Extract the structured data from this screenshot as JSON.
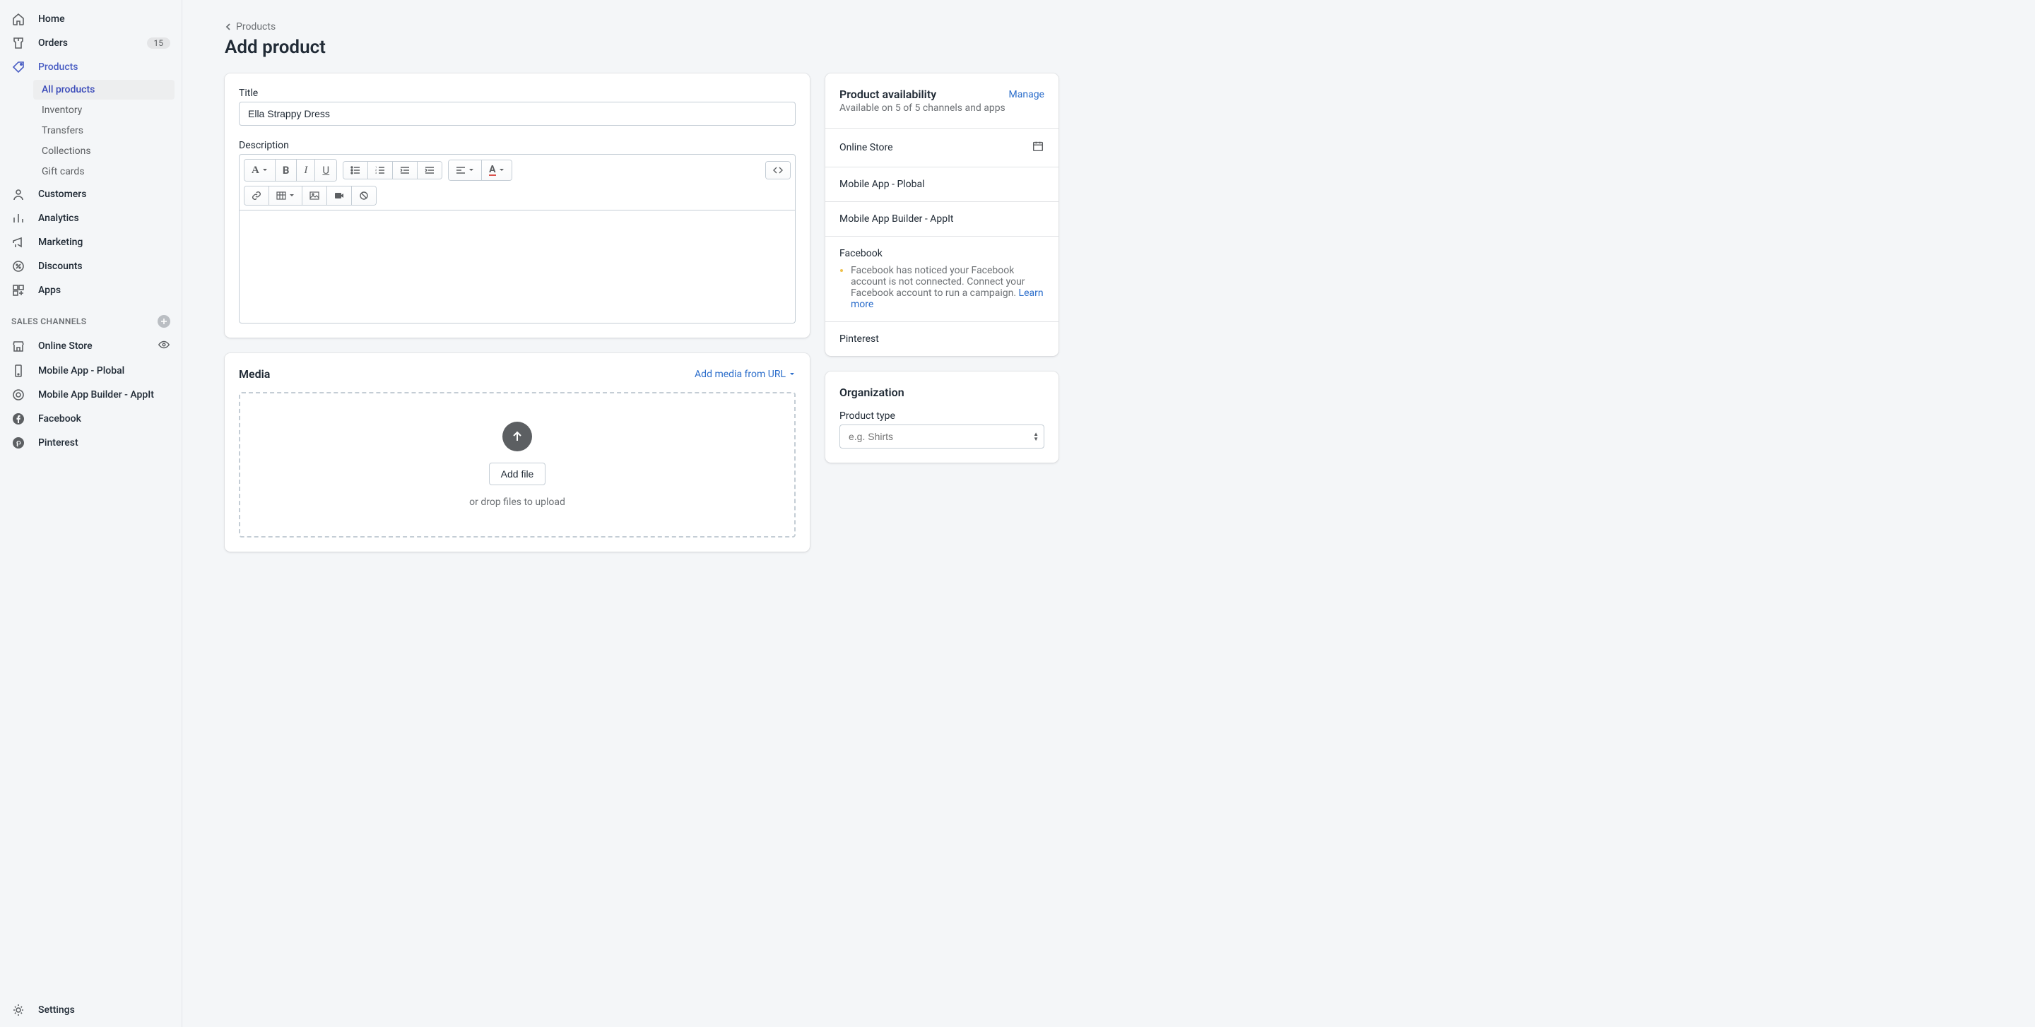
{
  "nav": {
    "home": "Home",
    "orders": "Orders",
    "orders_badge": "15",
    "products": "Products",
    "products_sub": {
      "all": "All products",
      "inventory": "Inventory",
      "transfers": "Transfers",
      "collections": "Collections",
      "gift_cards": "Gift cards"
    },
    "customers": "Customers",
    "analytics": "Analytics",
    "marketing": "Marketing",
    "discounts": "Discounts",
    "apps": "Apps"
  },
  "channels_heading": "SALES CHANNELS",
  "channels": {
    "online_store": "Online Store",
    "mobile_plobal": "Mobile App - Plobal",
    "mobile_appit": "Mobile App Builder - AppIt",
    "facebook": "Facebook",
    "pinterest": "Pinterest"
  },
  "settings": "Settings",
  "breadcrumb": "Products",
  "page_title": "Add product",
  "form": {
    "title_label": "Title",
    "title_value": "Ella Strappy Dress",
    "description_label": "Description"
  },
  "media": {
    "heading": "Media",
    "add_url": "Add media from URL",
    "add_file": "Add file",
    "drop_text": "or drop files to upload"
  },
  "availability": {
    "heading": "Product availability",
    "manage": "Manage",
    "subtext": "Available on 5 of 5 channels and apps",
    "online_store": "Online Store",
    "mobile_plobal": "Mobile App - Plobal",
    "mobile_appit": "Mobile App Builder - AppIt",
    "facebook": "Facebook",
    "facebook_warn": "Facebook has noticed your Facebook account is not connected. Connect your Facebook account to run a campaign. ",
    "learn_more": "Learn more",
    "pinterest": "Pinterest"
  },
  "organization": {
    "heading": "Organization",
    "product_type_label": "Product type",
    "product_type_placeholder": "e.g. Shirts"
  }
}
